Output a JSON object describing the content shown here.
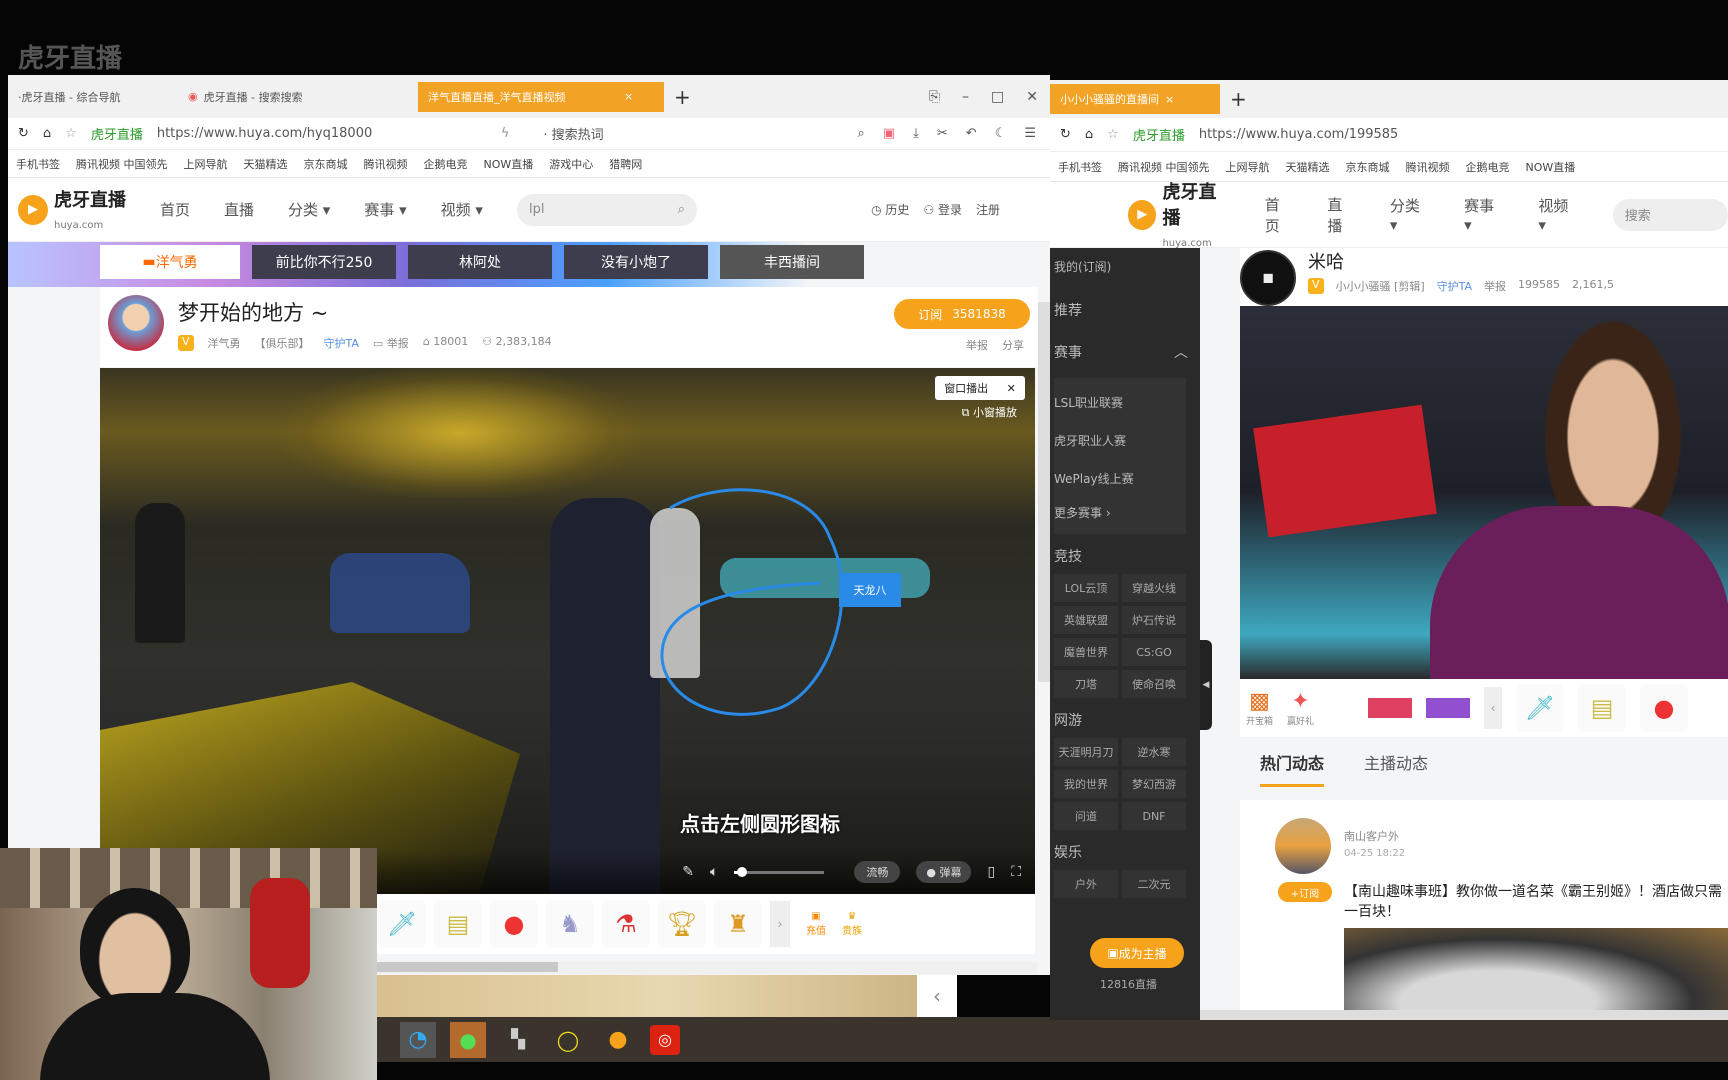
{
  "watermark": "虎牙直播",
  "left_window": {
    "tabs": [
      {
        "label": "·虎牙直播 - 综合导航"
      },
      {
        "label": "虎牙直播 - 搜索搜索"
      },
      {
        "label": "洋气直播直播_洋气直播视频",
        "active": true
      }
    ],
    "url_site": "虎牙直播",
    "url": "https://www.huya.com/hyq18000",
    "search_engine": "· 搜索热词",
    "bookmarks": [
      "手机书签",
      "腾讯视频 中国领先",
      "上网导航",
      "天猫精选",
      "京东商城",
      "腾讯视频",
      "企鹅电竞",
      "NOW直播",
      "游戏中心",
      "猎聘网"
    ],
    "nav": {
      "logo": "虎牙直播",
      "logo_sub": "huya.com",
      "items": [
        "首页",
        "直播",
        "分类 ▾",
        "赛事 ▾",
        "视频 ▾"
      ],
      "search_value": "lpl",
      "history": "历史",
      "login": "登录",
      "register": "注册"
    },
    "room_tabs": [
      "洋气勇",
      "前比你不行250",
      "林阿处",
      "没有小炮了",
      "丰西播间"
    ],
    "streamer": {
      "title": "梦开始的地方 ~",
      "name": "洋气勇",
      "guild": "【俱乐部】",
      "badge": "守护TA",
      "report": "举报",
      "room_id": "18001",
      "fans": "2,383,184",
      "subscribe": "订阅",
      "subscribe_count": "3581838",
      "pay": "举报",
      "share": "分享"
    },
    "video": {
      "popout": "窗口播出",
      "mini_play": "小窗播放",
      "caption": "点击左侧圆形图标",
      "annotation": "天龙八",
      "quality": "流畅",
      "danmu": "弹幕",
      "volume": 0.05
    },
    "gift_side": [
      {
        "label": "充值"
      },
      {
        "label": "贵族"
      }
    ]
  },
  "right_window": {
    "tab": "小小小骚骚的直播间",
    "url_site": "虎牙直播",
    "url": "https://www.huya.com/199585",
    "bookmarks": [
      "手机书签",
      "腾讯视频 中国领先",
      "上网导航",
      "天猫精选",
      "京东商城",
      "腾讯视频",
      "企鹅电竞",
      "NOW直播"
    ],
    "nav": {
      "logo": "虎牙直播",
      "logo_sub": "huya.com",
      "items": [
        "首页",
        "直播",
        "分类 ▾",
        "赛事 ▾",
        "视频 ▾"
      ],
      "search_value": "搜索"
    },
    "sidebar": {
      "top": [
        "我的(订阅)",
        "推荐",
        "赛事"
      ],
      "events": [
        "LSL职业联赛",
        "虎牙职业人赛",
        "WePlay线上赛",
        "更多赛事 ›"
      ],
      "section_game": "竞技",
      "games": [
        "LOL云顶",
        "穿越火线",
        "英雄联盟",
        "炉石传说",
        "魔兽世界",
        "CS:GO",
        "刀塔",
        "使命召唤"
      ],
      "section_net": "网游",
      "net_games": [
        "天涯明月刀",
        "逆水寒",
        "我的世界",
        "梦幻西游",
        "问道",
        "DNF"
      ],
      "section_ent": "娱乐",
      "ent": [
        "户外",
        "二次元"
      ],
      "bottom_btn": "成为主播",
      "count": "12816直播"
    },
    "streamer": {
      "name": "米哈",
      "guild": "小小小骚骚 [剪辑]",
      "badge": "守护TA",
      "report": "举报",
      "room_id": "199585",
      "fans": "2,161,5"
    },
    "gift_left": [
      {
        "label": "开宝箱"
      },
      {
        "label": "赢好礼"
      }
    ],
    "feed_tabs": [
      "热门动态",
      "主播动态"
    ],
    "post": {
      "author": "南山客户外",
      "time": "04-25 18:22",
      "tag": "+订阅",
      "text": "【南山趣味事班】教你做一道名菜《霸王别姬》！酒店做只需一百块！"
    }
  },
  "taskbar": {
    "apps": [
      "qq-browser",
      "wechat",
      "game-app",
      "yellow-ring-app",
      "huya-app",
      "netease-music"
    ]
  }
}
